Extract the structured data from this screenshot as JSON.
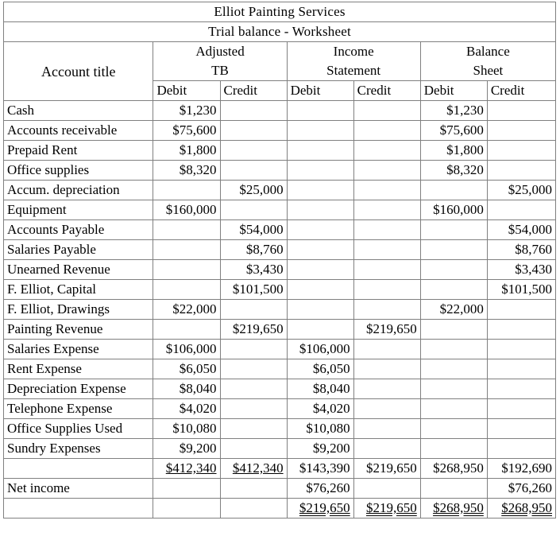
{
  "document": {
    "company": "Elliot Painting Services",
    "subtitle_main": "Trial balance",
    "subtitle_sep": " - ",
    "subtitle_tail": "Worksheet"
  },
  "table": {
    "account_col_header": "Account title",
    "groups": [
      {
        "line1": "Adjusted",
        "line2": "TB"
      },
      {
        "line1": "Income",
        "line2": "Statement"
      },
      {
        "line1": "Balance",
        "line2": "Sheet"
      }
    ],
    "sub_headers": [
      "Debit",
      "Credit",
      "Debit",
      "Credit",
      "Debit",
      "Credit"
    ],
    "rows": [
      {
        "title": "Cash",
        "atb_d": "$1,230",
        "atb_c": "",
        "is_d": "",
        "is_c": "",
        "bs_d": "$1,230",
        "bs_c": ""
      },
      {
        "title": "Accounts receivable",
        "atb_d": "$75,600",
        "atb_c": "",
        "is_d": "",
        "is_c": "",
        "bs_d": "$75,600",
        "bs_c": ""
      },
      {
        "title": "Prepaid Rent",
        "atb_d": "$1,800",
        "atb_c": "",
        "is_d": "",
        "is_c": "",
        "bs_d": "$1,800",
        "bs_c": ""
      },
      {
        "title": "Office supplies",
        "atb_d": "$8,320",
        "atb_c": "",
        "is_d": "",
        "is_c": "",
        "bs_d": "$8,320",
        "bs_c": ""
      },
      {
        "title": "Accum. depreciation",
        "atb_d": "",
        "atb_c": "$25,000",
        "is_d": "",
        "is_c": "",
        "bs_d": "",
        "bs_c": "$25,000"
      },
      {
        "title": "Equipment",
        "atb_d": "$160,000",
        "atb_c": "",
        "is_d": "",
        "is_c": "",
        "bs_d": "$160,000",
        "bs_c": ""
      },
      {
        "title": "Accounts Payable",
        "atb_d": "",
        "atb_c": "$54,000",
        "is_d": "",
        "is_c": "",
        "bs_d": "",
        "bs_c": "$54,000"
      },
      {
        "title": "Salaries Payable",
        "atb_d": "",
        "atb_c": "$8,760",
        "is_d": "",
        "is_c": "",
        "bs_d": "",
        "bs_c": "$8,760"
      },
      {
        "title": "Unearned Revenue",
        "atb_d": "",
        "atb_c": "$3,430",
        "is_d": "",
        "is_c": "",
        "bs_d": "",
        "bs_c": "$3,430"
      },
      {
        "title": "F. Elliot, Capital",
        "atb_d": "",
        "atb_c": "$101,500",
        "is_d": "",
        "is_c": "",
        "bs_d": "",
        "bs_c": "$101,500"
      },
      {
        "title": "F. Elliot, Drawings",
        "atb_d": "$22,000",
        "atb_c": "",
        "is_d": "",
        "is_c": "",
        "bs_d": "$22,000",
        "bs_c": ""
      },
      {
        "title": "Painting Revenue",
        "atb_d": "",
        "atb_c": "$219,650",
        "is_d": "",
        "is_c": "$219,650",
        "bs_d": "",
        "bs_c": ""
      },
      {
        "title": "Salaries Expense",
        "atb_d": "$106,000",
        "atb_c": "",
        "is_d": "$106,000",
        "is_c": "",
        "bs_d": "",
        "bs_c": ""
      },
      {
        "title": "Rent Expense",
        "atb_d": "$6,050",
        "atb_c": "",
        "is_d": "$6,050",
        "is_c": "",
        "bs_d": "",
        "bs_c": ""
      },
      {
        "title": "Depreciation Expense",
        "atb_d": "$8,040",
        "atb_c": "",
        "is_d": "$8,040",
        "is_c": "",
        "bs_d": "",
        "bs_c": ""
      },
      {
        "title": "Telephone Expense",
        "atb_d": "$4,020",
        "atb_c": "",
        "is_d": "$4,020",
        "is_c": "",
        "bs_d": "",
        "bs_c": ""
      },
      {
        "title": "Office Supplies Used",
        "atb_d": "$10,080",
        "atb_c": "",
        "is_d": "$10,080",
        "is_c": "",
        "bs_d": "",
        "bs_c": ""
      },
      {
        "title": "Sundry Expenses",
        "atb_d": "$9,200",
        "atb_c": "",
        "is_d": "$9,200",
        "is_c": "",
        "bs_d": "",
        "bs_c": ""
      }
    ],
    "subtotal_row": {
      "title": "",
      "atb_d": "$412,340",
      "atb_c": "$412,340",
      "is_d": "$143,390",
      "is_c": "$219,650",
      "bs_d": "$268,950",
      "bs_c": "$192,690"
    },
    "net_income_row": {
      "title": "Net income",
      "atb_d": "",
      "atb_c": "",
      "is_d": "$76,260",
      "is_c": "",
      "bs_d": "",
      "bs_c": "$76,260"
    },
    "grand_total_row": {
      "title": "",
      "atb_d": "",
      "atb_c": "",
      "is_d": "$219,650",
      "is_c": "$219,650",
      "bs_d": "$268,950",
      "bs_c": "$268,950"
    }
  }
}
